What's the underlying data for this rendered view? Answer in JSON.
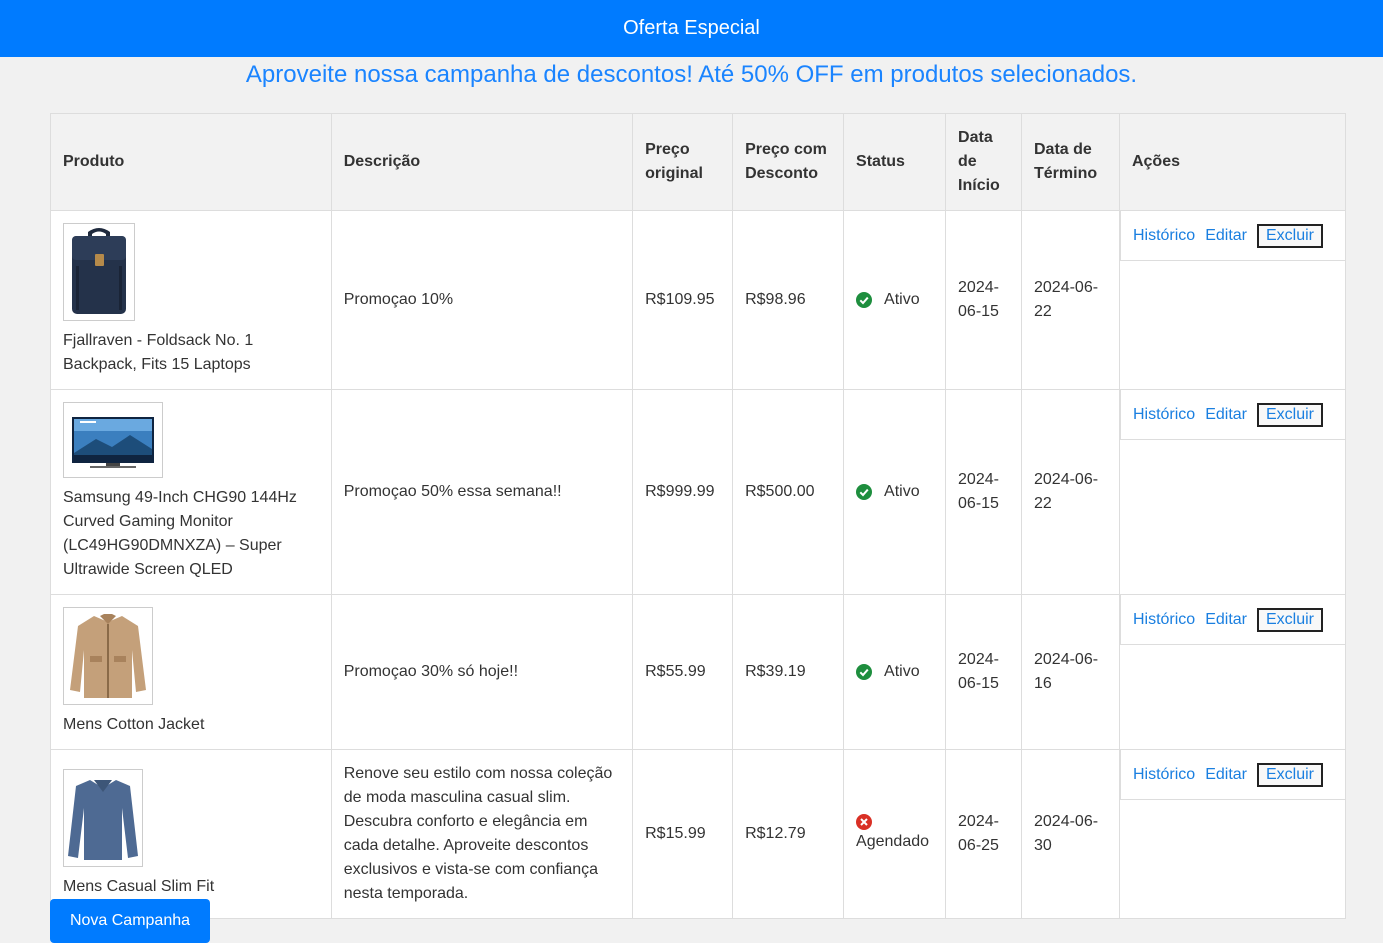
{
  "header": {
    "title": "Oferta Especial"
  },
  "banner": {
    "text": "Aproveite nossa campanha de descontos! Até 50% OFF em produtos selecionados."
  },
  "table": {
    "columns": {
      "produto": "Produto",
      "descricao": "Descrição",
      "preco_original": "Preço original",
      "preco_desconto": "Preço com Desconto",
      "status": "Status",
      "data_inicio": "Data de Início",
      "data_termino": "Data de Término",
      "acoes": "Ações"
    },
    "rows": [
      {
        "produto": "Fjallraven - Foldsack No. 1 Backpack, Fits 15 Laptops",
        "image_icon": "backpack-image",
        "descricao": "Promoçao 10%",
        "preco_original": "R$109.95",
        "preco_desconto": "R$98.96",
        "status": "Ativo",
        "status_icon": "check-circle-icon",
        "data_inicio": "2024-06-15",
        "data_termino": "2024-06-22"
      },
      {
        "produto": "Samsung 49-Inch CHG90 144Hz Curved Gaming Monitor (LC49HG90DMNXZA) – Super Ultrawide Screen QLED",
        "image_icon": "monitor-image",
        "descricao": "Promoçao 50% essa semana!!",
        "preco_original": "R$999.99",
        "preco_desconto": "R$500.00",
        "status": "Ativo",
        "status_icon": "check-circle-icon",
        "data_inicio": "2024-06-15",
        "data_termino": "2024-06-22"
      },
      {
        "produto": "Mens Cotton Jacket",
        "image_icon": "jacket-image",
        "descricao": "Promoçao 30% só hoje!!",
        "preco_original": "R$55.99",
        "preco_desconto": "R$39.19",
        "status": "Ativo",
        "status_icon": "check-circle-icon",
        "data_inicio": "2024-06-15",
        "data_termino": "2024-06-16"
      },
      {
        "produto": "Mens Casual Slim Fit",
        "image_icon": "shirt-image",
        "descricao": "Renove seu estilo com nossa coleção de moda masculina casual slim. Descubra conforto e elegância em cada detalhe. Aproveite descontos exclusivos e vista-se com confiança nesta temporada.",
        "preco_original": "R$15.99",
        "preco_desconto": "R$12.79",
        "status": "Agendado",
        "status_icon": "x-circle-icon",
        "data_inicio": "2024-06-25",
        "data_termino": "2024-06-30"
      }
    ],
    "actions": {
      "historico": "Histórico",
      "editar": "Editar",
      "excluir": "Excluir"
    }
  },
  "footer": {
    "nova_campanha": "Nova Campanha"
  },
  "colors": {
    "primary": "#007bff",
    "link": "#1a7fe0",
    "active": "#1e8e3e",
    "scheduled": "#d93025"
  }
}
